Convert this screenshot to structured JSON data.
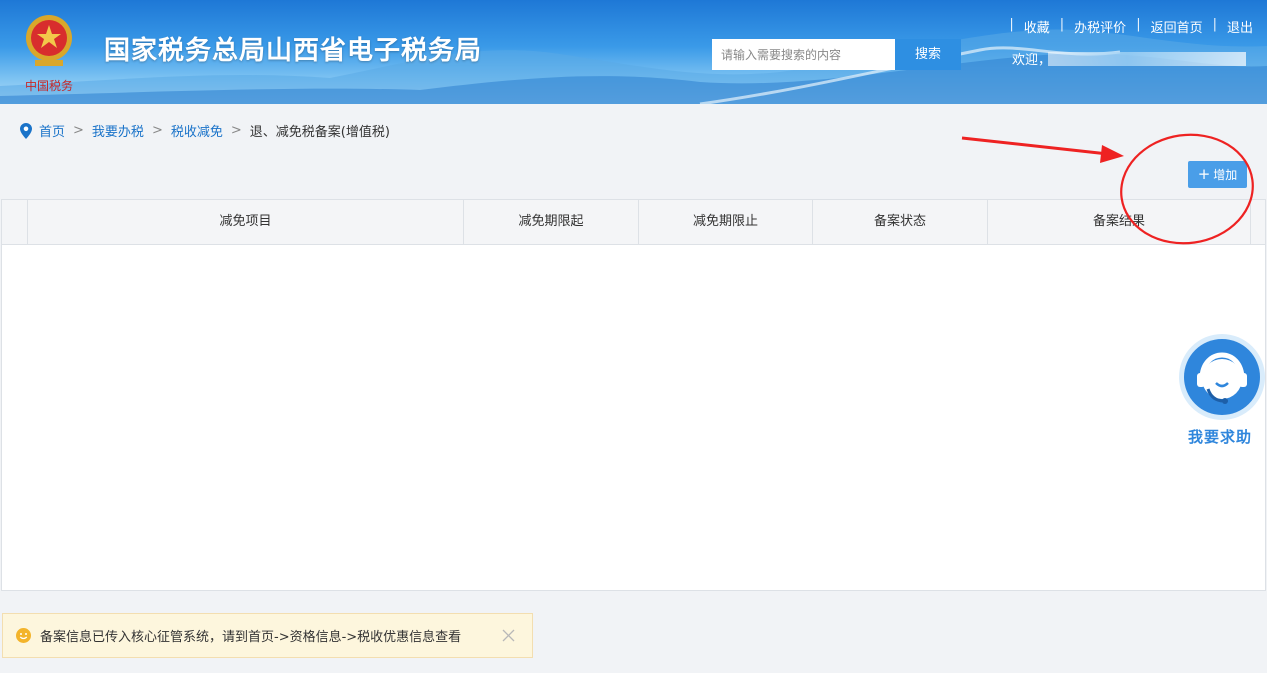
{
  "header": {
    "site_title": "国家税务总局山西省电子税务局",
    "emblem_text": "中国税务",
    "search": {
      "placeholder": "请输入需要搜索的内容",
      "button_label": "搜索"
    },
    "links": [
      "收藏",
      "办税评价",
      "返回首页",
      "退出"
    ],
    "welcome": "欢迎，"
  },
  "breadcrumb": {
    "items": [
      "首页",
      "我要办税",
      "税收减免"
    ],
    "separator": ">",
    "current": "退、减免税备案(增值税)"
  },
  "toolbar": {
    "add_label": "增加"
  },
  "table": {
    "columns": [
      "减免项目",
      "减免期限起",
      "减免期限止",
      "备案状态",
      "备案结果"
    ]
  },
  "help": {
    "label": "我要求助"
  },
  "notice": {
    "text": "备案信息已传入核心征管系统，请到首页->资格信息->税收优惠信息查看"
  },
  "colors": {
    "primary": "#2e8fe2",
    "link": "#1a73c9",
    "annotation": "#ee2222",
    "notice_bg": "#fdf6dd"
  }
}
